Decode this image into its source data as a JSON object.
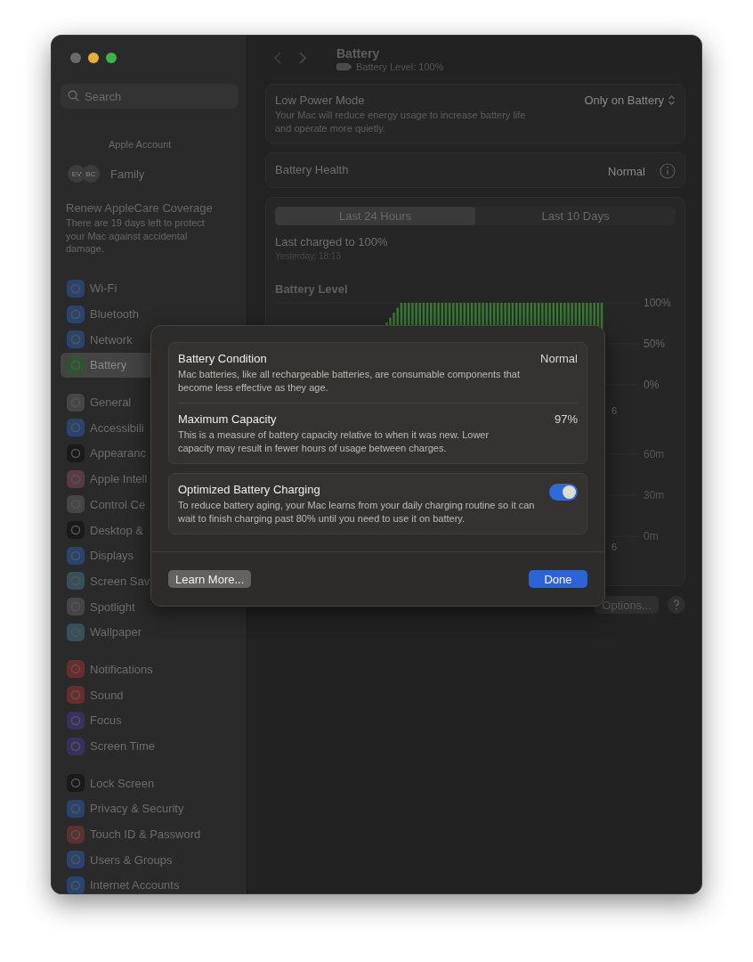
{
  "sidebar": {
    "search": {
      "placeholder": "Search"
    },
    "account": {
      "label": "Apple Account"
    },
    "family": {
      "label": "Family",
      "avatars": [
        "EV",
        "BC"
      ]
    },
    "applecare": {
      "title": "Renew AppleCare Coverage",
      "text": "There are 19 days left to protect your Mac against accidental damage."
    },
    "groups": [
      {
        "items": [
          {
            "label": "Wi-Fi",
            "color": "#2a4470",
            "selected": false
          },
          {
            "label": "Bluetooth",
            "color": "#2a4470",
            "selected": false
          },
          {
            "label": "Network",
            "color": "#2a4470",
            "selected": false
          },
          {
            "label": "Battery",
            "color": "#2f5530",
            "selected": true
          }
        ]
      },
      {
        "items": [
          {
            "label": "General",
            "color": "#464648",
            "selected": false
          },
          {
            "label": "Accessibili",
            "color": "#2a4470",
            "selected": false
          },
          {
            "label": "Appearanc",
            "color": "#1a1a1a",
            "selected": false
          },
          {
            "label": "Apple Intell",
            "color": "#5a3a44",
            "selected": false
          },
          {
            "label": "Control Ce",
            "color": "#464648",
            "selected": false
          },
          {
            "label": "Desktop &",
            "color": "#1a1a1a",
            "selected": false
          },
          {
            "label": "Displays",
            "color": "#2a4470",
            "selected": false
          },
          {
            "label": "Screen Sav",
            "color": "#35525c",
            "selected": false
          },
          {
            "label": "Spotlight",
            "color": "#464648",
            "selected": false
          },
          {
            "label": "Wallpaper",
            "color": "#35525c",
            "selected": false
          }
        ]
      },
      {
        "items": [
          {
            "label": "Notifications",
            "color": "#6a2c2c",
            "selected": false
          },
          {
            "label": "Sound",
            "color": "#6a2c2c",
            "selected": false
          },
          {
            "label": "Focus",
            "color": "#3a3060",
            "selected": false
          },
          {
            "label": "Screen Time",
            "color": "#3a3060",
            "selected": false
          }
        ]
      },
      {
        "items": [
          {
            "label": "Lock Screen",
            "color": "#1a1a1a",
            "selected": false
          },
          {
            "label": "Privacy & Security",
            "color": "#2a4470",
            "selected": false
          },
          {
            "label": "Touch ID & Password",
            "color": "#5a3030",
            "selected": false
          },
          {
            "label": "Users & Groups",
            "color": "#2a4470",
            "selected": false
          },
          {
            "label": "Internet Accounts",
            "color": "#2a4470",
            "selected": false
          }
        ]
      }
    ]
  },
  "header": {
    "title": "Battery",
    "subtitle": "Battery Level: 100%"
  },
  "low_power": {
    "title": "Low Power Mode",
    "text": "Your Mac will reduce energy usage to increase battery life and operate more quietly.",
    "value": "Only on Battery"
  },
  "health": {
    "title": "Battery Health",
    "value": "Normal"
  },
  "usage": {
    "tabs": [
      {
        "label": "Last 24 Hours",
        "selected": true
      },
      {
        "label": "Last 10 Days",
        "selected": false
      }
    ],
    "last_charged": "Last charged to 100%",
    "when": "Yesterday, 18:13",
    "chart_title": "Battery Level",
    "level_axis": {
      "y_labels": [
        "100%",
        "50%",
        "0%"
      ],
      "x_label": "6"
    },
    "usage_axis": {
      "y_labels": [
        "60m",
        "30m",
        "0m"
      ],
      "x_label": "6"
    }
  },
  "footer": {
    "options": "Options..."
  },
  "dialog": {
    "rows": [
      {
        "title": "Battery Condition",
        "text": "Mac batteries, like all rechargeable batteries, are consumable components that become less effective as they age.",
        "value": "Normal"
      },
      {
        "title": "Maximum Capacity",
        "text": "This is a measure of battery capacity relative to when it was new. Lower capacity may result in fewer hours of usage between charges.",
        "value": "97%"
      }
    ],
    "optimized": {
      "title": "Optimized Battery Charging",
      "text": "To reduce battery aging, your Mac learns from your daily charging routine so it can wait to finish charging past 80% until you need to use it on battery.",
      "on": true
    },
    "learn_more": "Learn More...",
    "done": "Done"
  }
}
